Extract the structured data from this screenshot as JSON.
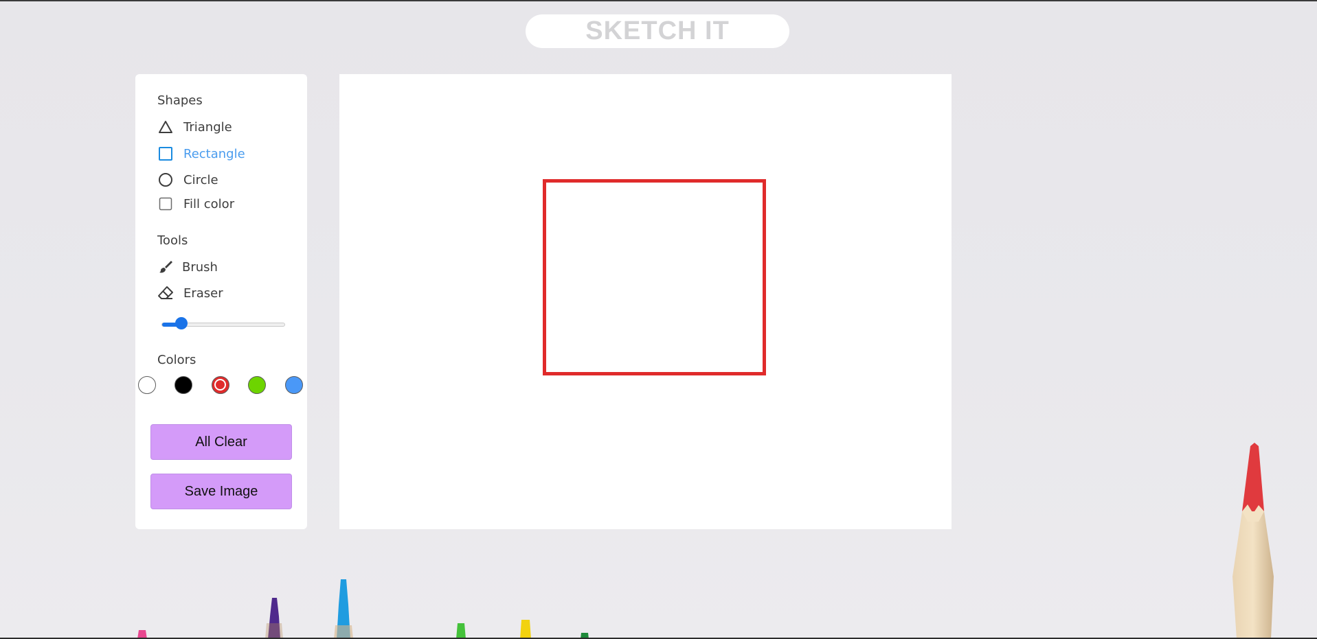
{
  "app": {
    "title": "SKETCH IT"
  },
  "sidebar": {
    "shapes_heading": "Shapes",
    "shapes": [
      {
        "label": "Triangle",
        "icon": "triangle-icon",
        "active": false
      },
      {
        "label": "Rectangle",
        "icon": "square-icon",
        "active": true
      },
      {
        "label": "Circle",
        "icon": "circle-icon",
        "active": false
      }
    ],
    "fill_color_label": "Fill color",
    "fill_color_checked": false,
    "tools_heading": "Tools",
    "tools": [
      {
        "label": "Brush",
        "icon": "brush-icon"
      },
      {
        "label": "Eraser",
        "icon": "eraser-icon"
      }
    ],
    "brush_size_fraction": 0.16,
    "colors_heading": "Colors",
    "colors": [
      {
        "hex": "#ffffff",
        "selected": false
      },
      {
        "hex": "#000000",
        "selected": false
      },
      {
        "hex": "#e02b2b",
        "selected": true
      },
      {
        "hex": "#6dd400",
        "selected": false
      },
      {
        "hex": "#4a98f7",
        "selected": false
      }
    ],
    "clear_label": "All Clear",
    "save_label": "Save Image"
  },
  "theme": {
    "accent": "#4a9cee",
    "button_bg": "#d49bf9",
    "stroke_color": "#e02b2b"
  },
  "canvas": {
    "drawn_shapes": [
      {
        "type": "rectangle",
        "stroke": "#e02b2b",
        "fill": "none"
      }
    ]
  }
}
